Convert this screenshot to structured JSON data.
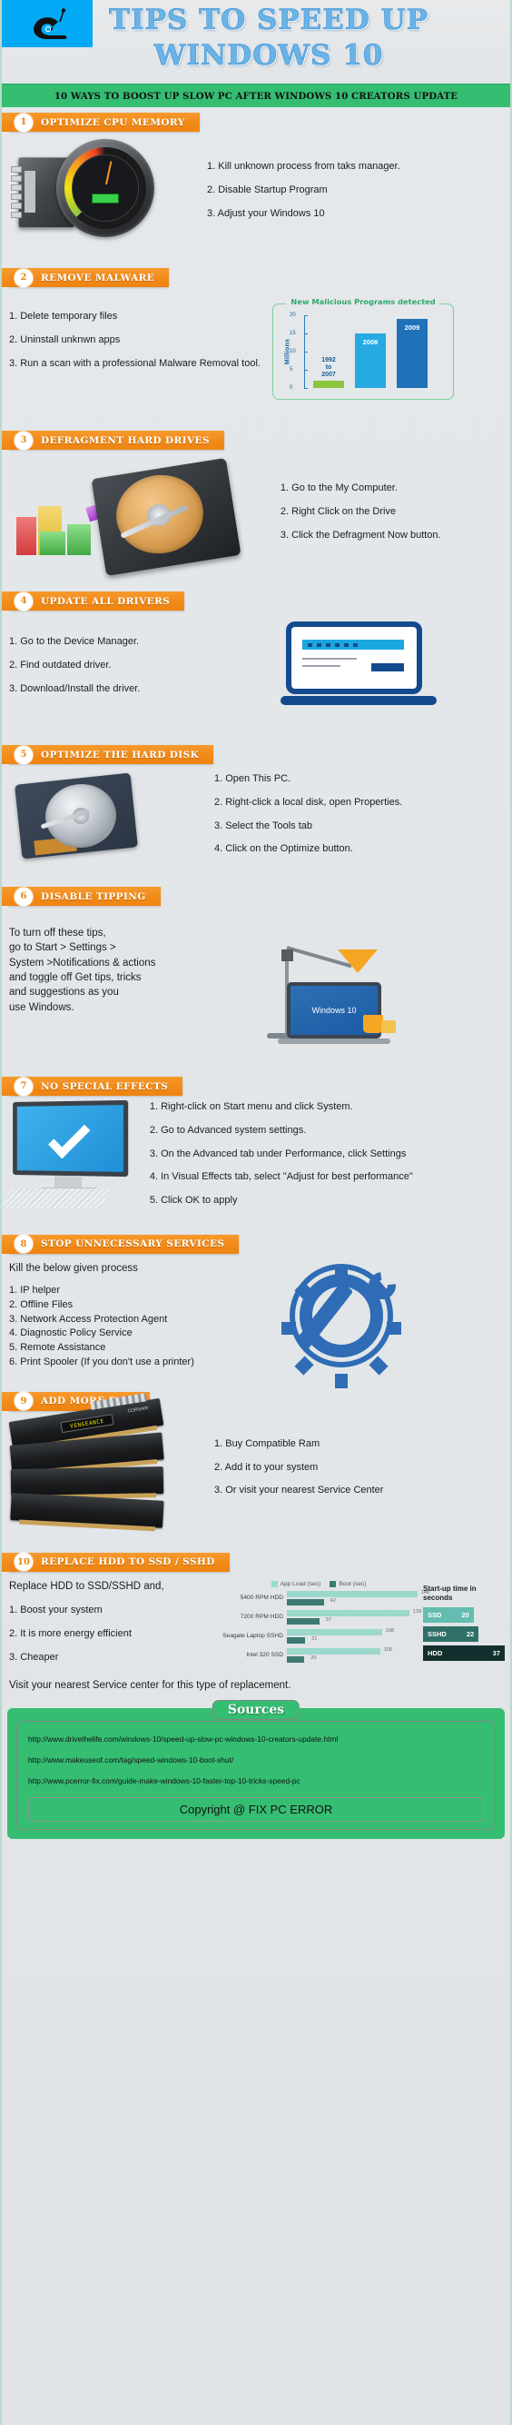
{
  "header": {
    "title_line1": "TIPS TO SPEED UP",
    "title_line2": "WINDOWS 10",
    "snail_icon": "snail-icon",
    "subtitle": "10 WAYS TO BOOST UP SLOW PC AFTER WINDOWS 10 CREATORS UPDATE"
  },
  "sections": [
    {
      "number": "1",
      "title": "OPTIMIZE CPU MEMORY",
      "steps": [
        "1. Kill unknown process from taks manager.",
        "2. Disable Startup Program",
        "3. Adjust your Windows 10"
      ],
      "art": "cpu-gauge-illustration"
    },
    {
      "number": "2",
      "title": "REMOVE MALWARE",
      "steps": [
        "1. Delete temporary files",
        "2. Uninstall unknwn apps",
        "3. Run a scan with a professional Malware Removal tool."
      ],
      "art": "malware-chart"
    },
    {
      "number": "3",
      "title": "DEFRAGMENT HARD DRIVES",
      "steps": [
        "1. Go to the My Computer.",
        "2. Right Click on the Drive",
        "3. Click the Defragment Now button."
      ],
      "art": "hard-drive-illustration"
    },
    {
      "number": "4",
      "title": "UPDATE ALL DRIVERS",
      "steps": [
        "1. Go to the Device Manager.",
        "2. Find outdated driver.",
        "3. Download/Install the driver."
      ],
      "art": "laptop-illustration"
    },
    {
      "number": "5",
      "title": "OPTIMIZE THE HARD DISK",
      "steps": [
        "1. Open This PC.",
        "2. Right-click a local disk, open Properties.",
        "3. Select the Tools tab",
        "4. Click on the Optimize button."
      ],
      "art": "open-hard-disk-illustration"
    },
    {
      "number": "6",
      "title": "DISABLE TIPPING",
      "paragraph": "To turn off these tips,\ngo to Start > Settings >\nSystem >Notifications & actions\nand toggle off Get tips, tricks\nand suggestions as you\nuse Windows.",
      "art": "desk-lamp-laptop-illustration",
      "laptop_logo": "Windows 10"
    },
    {
      "number": "7",
      "title": "NO SPECIAL EFFECTS",
      "steps": [
        "1. Right-click on Start menu and click System.",
        "2. Go to Advanced system settings.",
        "3. On the Advanced tab under Performance, click Settings",
        "4. In Visual Effects tab, select \"Adjust for best performance\"",
        "5. Click OK to apply"
      ],
      "art": "monitor-check-illustration"
    },
    {
      "number": "8",
      "title": "STOP UNNECESSARY SERVICES",
      "lead": "Kill the below given process",
      "steps": [
        "1. IP helper",
        "2. Offline Files",
        "3. Network Access Protection Agent",
        "4. Diagnostic Policy Service",
        "5. Remote Assistance",
        "6. Print Spooler (If you don't use a printer)"
      ],
      "art": "gear-wrench-illustration"
    },
    {
      "number": "9",
      "title": "ADD MORE RAM",
      "steps": [
        "1. Buy Compatible Ram",
        "2. Add it to your system",
        "3. Or visit your nearest Service Center"
      ],
      "art": "ram-modules-illustration",
      "ram_label": "VENGEANCE",
      "ram_brand": "CORSAIR"
    },
    {
      "number": "10",
      "title": "REPLACE HDD TO SSD / SSHD",
      "lead": "Replace HDD to SSD/SSHD and,",
      "steps": [
        "1. Boost your system",
        "2. It is more energy efficient",
        "3. Cheaper"
      ],
      "closing": "Visit your nearest Service center for this type of replacement.",
      "art": "ssd-benchmark-chart"
    }
  ],
  "chart_data": [
    {
      "type": "bar",
      "title": "New Malicious Programs detected",
      "xlabel": "",
      "ylabel": "Millions",
      "categories": [
        "1992 to 2007",
        "2008",
        "2009"
      ],
      "values": [
        2,
        15,
        19
      ],
      "bar_labels": [
        "1992\nto\n2007",
        "2008",
        "2009"
      ],
      "colors": [
        "#8cc63f",
        "#27a9e1",
        "#1f71b8"
      ],
      "ylim": [
        0,
        20
      ],
      "yticks": [
        0,
        5,
        10,
        15,
        20
      ],
      "grid": false,
      "legend": "none"
    },
    {
      "type": "bar",
      "title": "",
      "orientation": "horizontal",
      "categories": [
        "5400 RPM HDD",
        "7200 RPM HDD",
        "Seagate Laptop SSHD",
        "Intel 320 SSD"
      ],
      "series": [
        {
          "name": "App Load (sec)",
          "values": [
            148,
            139,
            108,
            106
          ],
          "color": "#9ad9cc"
        },
        {
          "name": "Boot (sec)",
          "values": [
            42,
            37,
            21,
            20
          ],
          "color": "#3c7a72"
        }
      ],
      "legend": "top",
      "xlim": [
        0,
        160
      ],
      "grid": false
    },
    {
      "type": "bar",
      "title": "Start-up time in seconds",
      "orientation": "horizontal",
      "categories": [
        "SSD",
        "SSHD",
        "HDD"
      ],
      "values": [
        20,
        22,
        37
      ],
      "colors": [
        "#63bdb0",
        "#2f6f68",
        "#14302e"
      ],
      "xlim": [
        0,
        40
      ],
      "legend": "none",
      "grid": false
    }
  ],
  "footer": {
    "sources_label": "Sources",
    "links": [
      "http://www.drivethelife.com/windows-10/speed-up-slow-pc-windows-10-creators-update.html",
      "http://www.makeuseof.com/tag/speed-windows-10-boot-shut/",
      "http://www.pcerror-fix.com/guide-make-windows-10-faster-top-10-tricks-speed-pc"
    ],
    "copyright": "Copyright @ FIX PC ERROR"
  },
  "colors": {
    "accent_orange": "#f18a18",
    "accent_green": "#35bd72",
    "accent_blue": "#03a9f4",
    "title_blue": "#69b3e7",
    "background": "#e2e6e8"
  }
}
